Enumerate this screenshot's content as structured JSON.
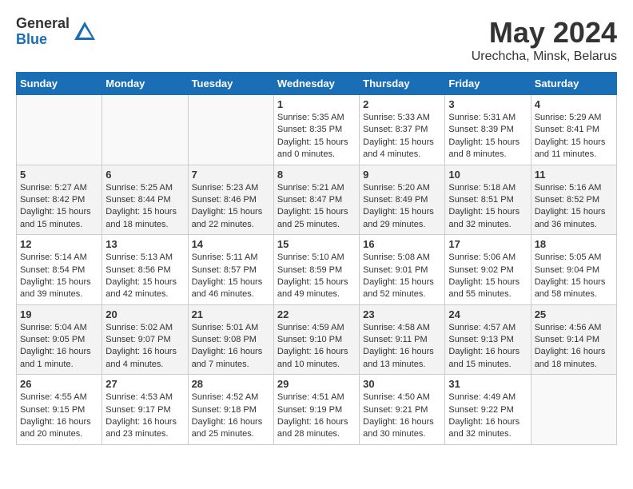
{
  "header": {
    "logo_general": "General",
    "logo_blue": "Blue",
    "month_title": "May 2024",
    "location": "Urechcha, Minsk, Belarus"
  },
  "weekdays": [
    "Sunday",
    "Monday",
    "Tuesday",
    "Wednesday",
    "Thursday",
    "Friday",
    "Saturday"
  ],
  "weeks": [
    [
      {
        "day": "",
        "info": ""
      },
      {
        "day": "",
        "info": ""
      },
      {
        "day": "",
        "info": ""
      },
      {
        "day": "1",
        "info": "Sunrise: 5:35 AM\nSunset: 8:35 PM\nDaylight: 15 hours\nand 0 minutes."
      },
      {
        "day": "2",
        "info": "Sunrise: 5:33 AM\nSunset: 8:37 PM\nDaylight: 15 hours\nand 4 minutes."
      },
      {
        "day": "3",
        "info": "Sunrise: 5:31 AM\nSunset: 8:39 PM\nDaylight: 15 hours\nand 8 minutes."
      },
      {
        "day": "4",
        "info": "Sunrise: 5:29 AM\nSunset: 8:41 PM\nDaylight: 15 hours\nand 11 minutes."
      }
    ],
    [
      {
        "day": "5",
        "info": "Sunrise: 5:27 AM\nSunset: 8:42 PM\nDaylight: 15 hours\nand 15 minutes."
      },
      {
        "day": "6",
        "info": "Sunrise: 5:25 AM\nSunset: 8:44 PM\nDaylight: 15 hours\nand 18 minutes."
      },
      {
        "day": "7",
        "info": "Sunrise: 5:23 AM\nSunset: 8:46 PM\nDaylight: 15 hours\nand 22 minutes."
      },
      {
        "day": "8",
        "info": "Sunrise: 5:21 AM\nSunset: 8:47 PM\nDaylight: 15 hours\nand 25 minutes."
      },
      {
        "day": "9",
        "info": "Sunrise: 5:20 AM\nSunset: 8:49 PM\nDaylight: 15 hours\nand 29 minutes."
      },
      {
        "day": "10",
        "info": "Sunrise: 5:18 AM\nSunset: 8:51 PM\nDaylight: 15 hours\nand 32 minutes."
      },
      {
        "day": "11",
        "info": "Sunrise: 5:16 AM\nSunset: 8:52 PM\nDaylight: 15 hours\nand 36 minutes."
      }
    ],
    [
      {
        "day": "12",
        "info": "Sunrise: 5:14 AM\nSunset: 8:54 PM\nDaylight: 15 hours\nand 39 minutes."
      },
      {
        "day": "13",
        "info": "Sunrise: 5:13 AM\nSunset: 8:56 PM\nDaylight: 15 hours\nand 42 minutes."
      },
      {
        "day": "14",
        "info": "Sunrise: 5:11 AM\nSunset: 8:57 PM\nDaylight: 15 hours\nand 46 minutes."
      },
      {
        "day": "15",
        "info": "Sunrise: 5:10 AM\nSunset: 8:59 PM\nDaylight: 15 hours\nand 49 minutes."
      },
      {
        "day": "16",
        "info": "Sunrise: 5:08 AM\nSunset: 9:01 PM\nDaylight: 15 hours\nand 52 minutes."
      },
      {
        "day": "17",
        "info": "Sunrise: 5:06 AM\nSunset: 9:02 PM\nDaylight: 15 hours\nand 55 minutes."
      },
      {
        "day": "18",
        "info": "Sunrise: 5:05 AM\nSunset: 9:04 PM\nDaylight: 15 hours\nand 58 minutes."
      }
    ],
    [
      {
        "day": "19",
        "info": "Sunrise: 5:04 AM\nSunset: 9:05 PM\nDaylight: 16 hours\nand 1 minute."
      },
      {
        "day": "20",
        "info": "Sunrise: 5:02 AM\nSunset: 9:07 PM\nDaylight: 16 hours\nand 4 minutes."
      },
      {
        "day": "21",
        "info": "Sunrise: 5:01 AM\nSunset: 9:08 PM\nDaylight: 16 hours\nand 7 minutes."
      },
      {
        "day": "22",
        "info": "Sunrise: 4:59 AM\nSunset: 9:10 PM\nDaylight: 16 hours\nand 10 minutes."
      },
      {
        "day": "23",
        "info": "Sunrise: 4:58 AM\nSunset: 9:11 PM\nDaylight: 16 hours\nand 13 minutes."
      },
      {
        "day": "24",
        "info": "Sunrise: 4:57 AM\nSunset: 9:13 PM\nDaylight: 16 hours\nand 15 minutes."
      },
      {
        "day": "25",
        "info": "Sunrise: 4:56 AM\nSunset: 9:14 PM\nDaylight: 16 hours\nand 18 minutes."
      }
    ],
    [
      {
        "day": "26",
        "info": "Sunrise: 4:55 AM\nSunset: 9:15 PM\nDaylight: 16 hours\nand 20 minutes."
      },
      {
        "day": "27",
        "info": "Sunrise: 4:53 AM\nSunset: 9:17 PM\nDaylight: 16 hours\nand 23 minutes."
      },
      {
        "day": "28",
        "info": "Sunrise: 4:52 AM\nSunset: 9:18 PM\nDaylight: 16 hours\nand 25 minutes."
      },
      {
        "day": "29",
        "info": "Sunrise: 4:51 AM\nSunset: 9:19 PM\nDaylight: 16 hours\nand 28 minutes."
      },
      {
        "day": "30",
        "info": "Sunrise: 4:50 AM\nSunset: 9:21 PM\nDaylight: 16 hours\nand 30 minutes."
      },
      {
        "day": "31",
        "info": "Sunrise: 4:49 AM\nSunset: 9:22 PM\nDaylight: 16 hours\nand 32 minutes."
      },
      {
        "day": "",
        "info": ""
      }
    ]
  ]
}
